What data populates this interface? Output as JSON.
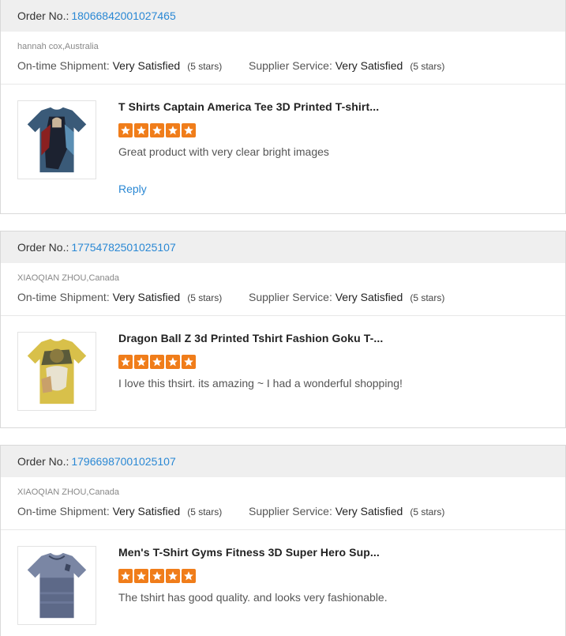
{
  "labels": {
    "order_no": "Order No.:",
    "on_time_shipment": "On-time Shipment:",
    "supplier_service": "Supplier Service:",
    "reply": "Reply"
  },
  "reviews": [
    {
      "order_number": "18066842001027465",
      "buyer": "hannah cox,Australia",
      "shipment_rating": "Very Satisfied",
      "shipment_stars_text": "(5 stars)",
      "service_rating": "Very Satisfied",
      "service_stars_text": "(5 stars)",
      "product_title": "T Shirts Captain America Tee 3D Printed T-shirt...",
      "stars": 5,
      "review_text": "Great product with very clear bright images",
      "has_reply": true
    },
    {
      "order_number": "17754782501025107",
      "buyer": "XIAOQIAN ZHOU,Canada",
      "shipment_rating": "Very Satisfied",
      "shipment_stars_text": "(5 stars)",
      "service_rating": "Very Satisfied",
      "service_stars_text": "(5 stars)",
      "product_title": "Dragon Ball Z 3d Printed Tshirt Fashion Goku T-...",
      "stars": 5,
      "review_text": "I love this thsirt. its amazing ~ I had a wonderful shopping!",
      "has_reply": false
    },
    {
      "order_number": "17966987001025107",
      "buyer": "XIAOQIAN ZHOU,Canada",
      "shipment_rating": "Very Satisfied",
      "shipment_stars_text": "(5 stars)",
      "service_rating": "Very Satisfied",
      "service_stars_text": "(5 stars)",
      "product_title": "Men's T-Shirt Gyms Fitness 3D Super Hero Sup...",
      "stars": 5,
      "review_text": "The tshirt has good quality.  and looks very fashionable.",
      "has_reply": false
    }
  ],
  "colors": {
    "accent_link": "#2a88d4",
    "star": "#f07d1a",
    "header_bg": "#efefef"
  }
}
